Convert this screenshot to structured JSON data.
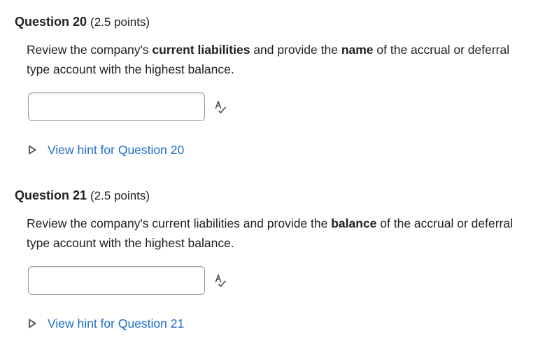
{
  "questions": [
    {
      "title": "Question 20",
      "points": "(2.5 points)",
      "body_parts": [
        {
          "text": "Review the company's ",
          "bold": false
        },
        {
          "text": "current liabilities",
          "bold": true
        },
        {
          "text": " and provide the ",
          "bold": false
        },
        {
          "text": "name",
          "bold": true
        },
        {
          "text": " of the accrual or deferral type account with the highest balance.",
          "bold": false
        }
      ],
      "answer_value": "",
      "hint_label": "View hint for Question 20"
    },
    {
      "title": "Question 21",
      "points": "(2.5 points)",
      "body_parts": [
        {
          "text": "Review the company's current liabilities and provide the ",
          "bold": false
        },
        {
          "text": "balance",
          "bold": true
        },
        {
          "text": " of the accrual or deferral type account with the highest balance.",
          "bold": false
        }
      ],
      "answer_value": "",
      "hint_label": "View hint for Question 21"
    }
  ],
  "icons": {
    "spellcheck": "spellcheck-icon",
    "hint_toggle": "triangle-right-icon"
  },
  "colors": {
    "link": "#1d6bc8",
    "text": "#202122",
    "input_border": "#9a9a9a"
  }
}
